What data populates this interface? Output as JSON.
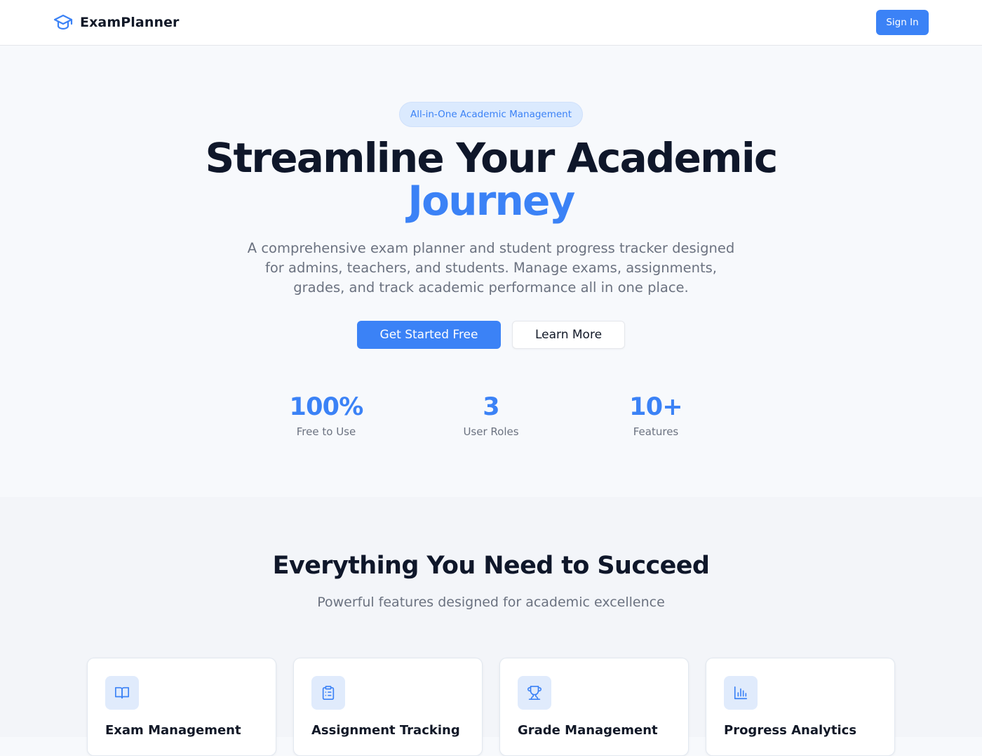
{
  "colors": {
    "accent": "#3b82f6",
    "accent_light": "#dbeafe",
    "text_dark": "#0f172a",
    "text_muted": "#6b7280",
    "background": "#f7f9fc"
  },
  "header": {
    "logo_icon": "graduation-cap-icon",
    "brand_name": "ExamPlanner",
    "signin_label": "Sign In"
  },
  "hero": {
    "badge": "All-in-One Academic Management",
    "title_line1": "Streamline Your Academic",
    "title_line2": "Journey",
    "description": "A comprehensive exam planner and student progress tracker designed for admins, teachers, and students. Manage exams, assignments, grades, and track academic performance all in one place.",
    "cta_primary": "Get Started Free",
    "cta_secondary": "Learn More",
    "stats": [
      {
        "value": "100%",
        "label": "Free to Use"
      },
      {
        "value": "3",
        "label": "User Roles"
      },
      {
        "value": "10+",
        "label": "Features"
      }
    ]
  },
  "features": {
    "title": "Everything You Need to Succeed",
    "subtitle": "Powerful features designed for academic excellence",
    "cards": [
      {
        "icon": "book-open-icon",
        "title": "Exam Management"
      },
      {
        "icon": "clipboard-list-icon",
        "title": "Assignment Tracking"
      },
      {
        "icon": "trophy-icon",
        "title": "Grade Management"
      },
      {
        "icon": "bar-chart-icon",
        "title": "Progress Analytics"
      }
    ]
  }
}
